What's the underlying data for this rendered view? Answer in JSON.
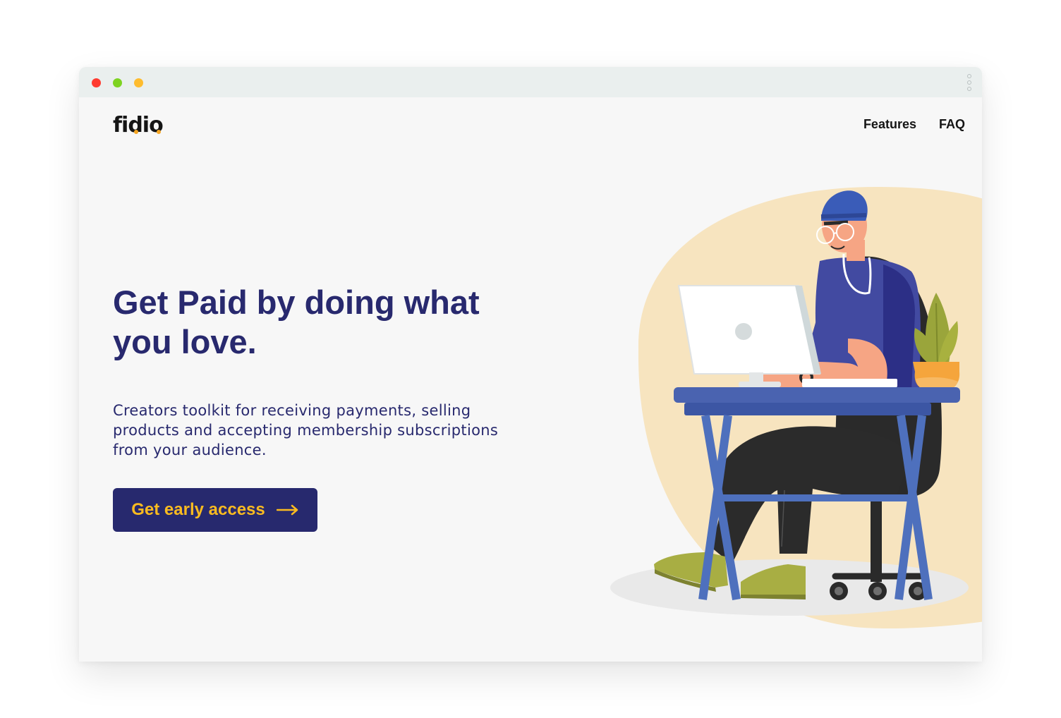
{
  "browser": {
    "controls": [
      "close",
      "minimize",
      "maximize"
    ],
    "menu_icon": "more-vertical-icon"
  },
  "header": {
    "logo_text": "fidio",
    "nav": [
      {
        "label": "Features"
      },
      {
        "label": "FAQ"
      }
    ]
  },
  "hero": {
    "title": "Get Paid by doing what you love.",
    "subtitle": "Creators toolkit for receiving payments, selling products and accepting membership subscriptions from your audience.",
    "cta_label": "Get early access",
    "cta_icon": "arrow-right-icon"
  },
  "colors": {
    "primary": "#27296e",
    "accent": "#fbbb20",
    "background": "#f7f7f7",
    "illustration_blob": "#f7e4bf"
  }
}
